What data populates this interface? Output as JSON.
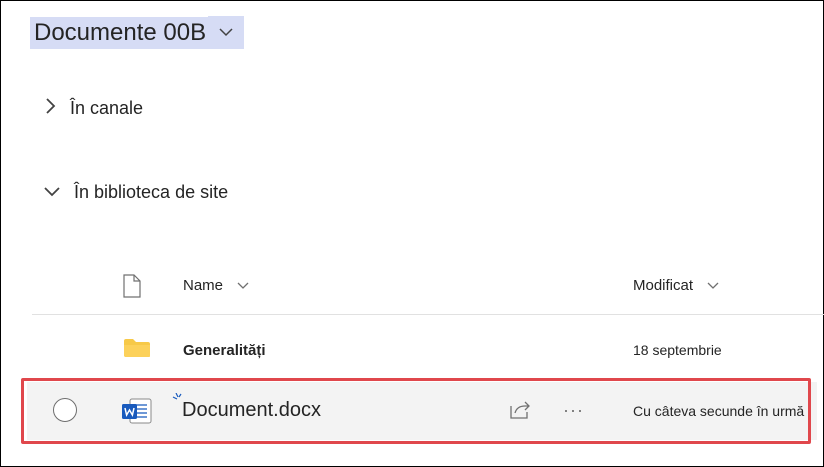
{
  "library": {
    "title": "Documente 00B"
  },
  "sections": [
    {
      "label": "În canale"
    },
    {
      "label": "În biblioteca de site"
    }
  ],
  "columns": {
    "name": "Name",
    "modified": "Modificat"
  },
  "rows": [
    {
      "name": "Generalități",
      "modified": "18 septembrie",
      "type": "folder"
    },
    {
      "name": "Document.docx",
      "modified": "Cu câteva secunde în urmă",
      "type": "word-document"
    }
  ],
  "colors": {
    "title_highlight": "#d6dcf5",
    "word_blue": "#185abd",
    "folder_yellow": "#f7c948",
    "selection_border": "#e0474c"
  }
}
